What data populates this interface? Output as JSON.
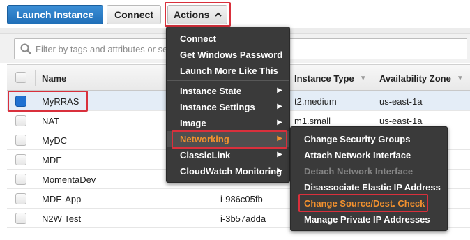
{
  "toolbar": {
    "launch_label": "Launch Instance",
    "connect_label": "Connect",
    "actions_label": "Actions"
  },
  "filter": {
    "placeholder": "Filter by tags and attributes or se"
  },
  "table": {
    "headers": {
      "name": "Name",
      "instance_type": "Instance Type",
      "availability_zone": "Availability Zone"
    },
    "rows": [
      {
        "name": "MyRRAS",
        "id": "",
        "type": "t2.medium",
        "az": "us-east-1a",
        "selected": true
      },
      {
        "name": "NAT",
        "id": "",
        "type": "m1.small",
        "az": "us-east-1a",
        "selected": false
      },
      {
        "name": "MyDC",
        "id": "",
        "type": "",
        "az": "",
        "selected": false
      },
      {
        "name": "MDE",
        "id": "",
        "type": "",
        "az": "",
        "selected": false
      },
      {
        "name": "MomentaDev",
        "id": "",
        "type": "",
        "az": "",
        "selected": false
      },
      {
        "name": "MDE-App",
        "id": "i-986c05fb",
        "type": "",
        "az": "",
        "selected": false
      },
      {
        "name": "N2W Test",
        "id": "i-3b57adda",
        "type": "",
        "az": "",
        "selected": false
      }
    ]
  },
  "actions_menu": {
    "items": [
      "Connect",
      "Get Windows Password",
      "Launch More Like This",
      "Instance State",
      "Instance Settings",
      "Image",
      "Networking",
      "ClassicLink",
      "CloudWatch Monitoring"
    ]
  },
  "networking_menu": {
    "items": [
      "Change Security Groups",
      "Attach Network Interface",
      "Detach Network Interface",
      "Disassociate Elastic IP Address",
      "Change Source/Dest. Check",
      "Manage Private IP Addresses"
    ]
  },
  "colors": {
    "primary_button": "#1f6fb8",
    "highlight_border": "#d9303c",
    "menu_bg": "#3a3a3a",
    "menu_active_text": "#f2912e",
    "checkbox_checked": "#2071d1",
    "selected_row": "#e4edf7"
  }
}
